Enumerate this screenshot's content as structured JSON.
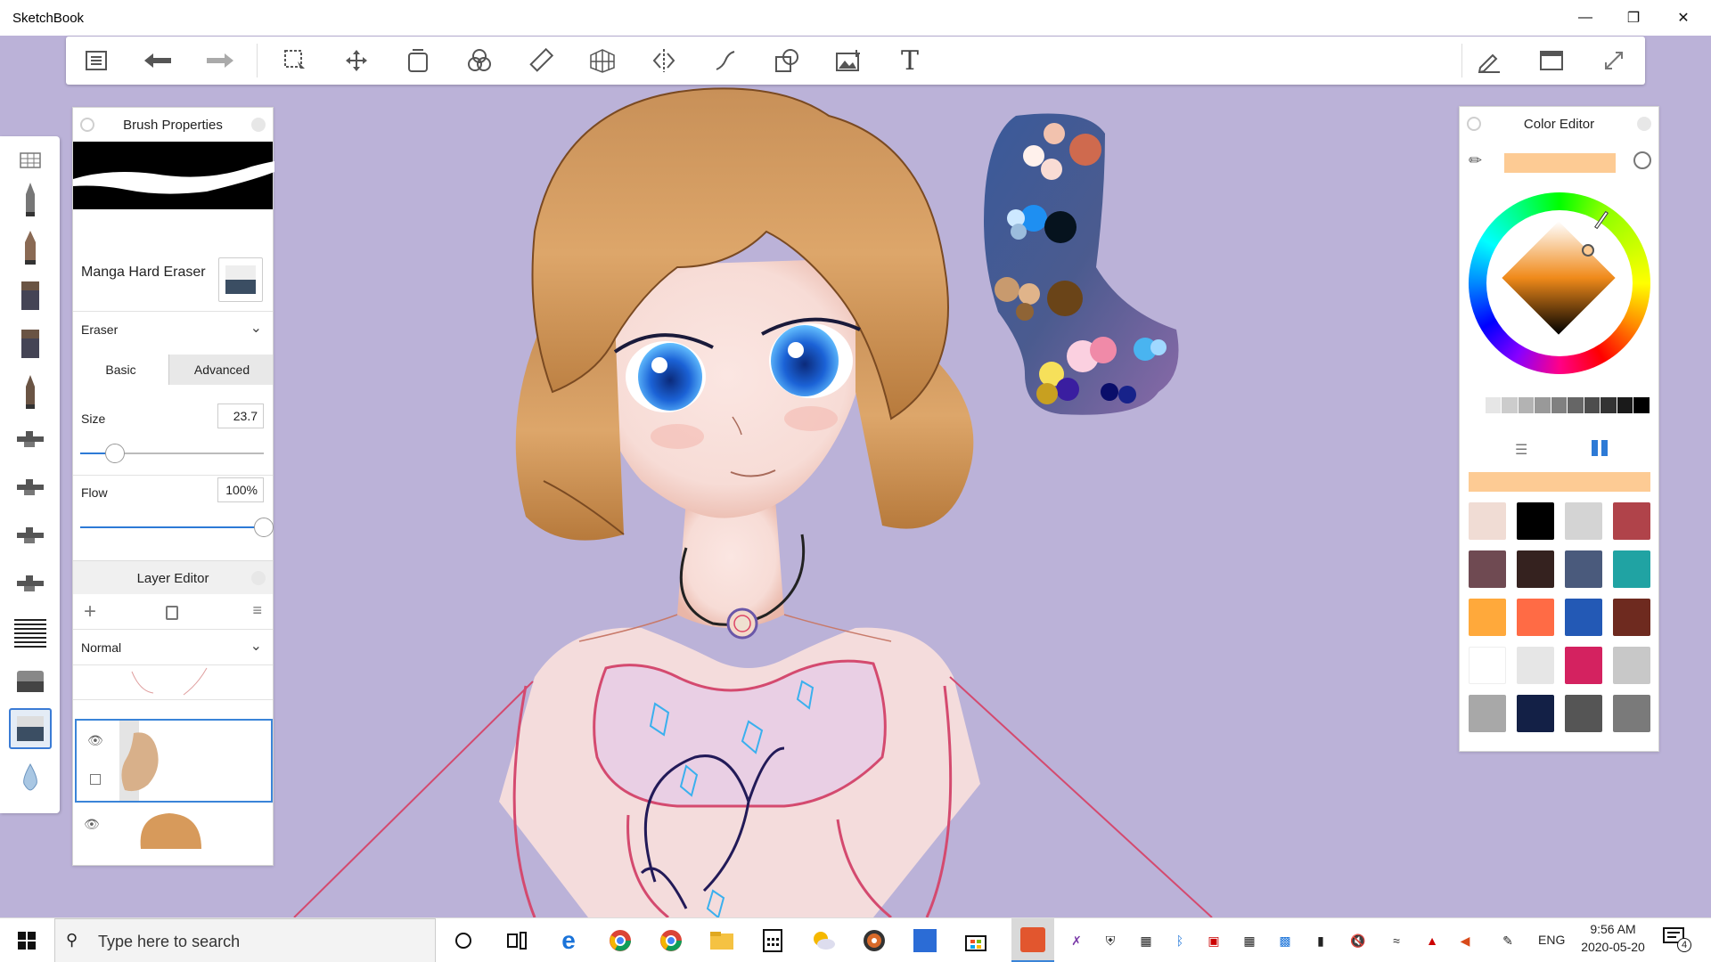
{
  "app": {
    "title": "SketchBook"
  },
  "window": {
    "minimize_icon": "minimize-icon",
    "restore_icon": "restore-icon",
    "close_icon": "close-icon"
  },
  "toolbar": {
    "icons": [
      "menu-list-icon",
      "undo-icon",
      "redo-icon",
      "selection-icon",
      "move-icon",
      "layer-fill-icon",
      "color-mix-icon",
      "ruler-icon",
      "perspective-icon",
      "symmetry-icon",
      "stroke-icon",
      "shape-icon",
      "insert-image-icon",
      "text-icon"
    ],
    "right_icons": [
      "pen-icon",
      "window-icon",
      "fullscreen-icon"
    ]
  },
  "brush": {
    "panel_title": "Brush Properties",
    "name": "Manga Hard Eraser",
    "category": "Eraser",
    "tab_basic": "Basic",
    "tab_advanced": "Advanced",
    "size_label": "Size",
    "size_value": "23.7",
    "size_fraction": 0.19,
    "flow_label": "Flow",
    "flow_value": "100%",
    "flow_fraction": 1.0
  },
  "layers": {
    "panel_title": "Layer Editor",
    "blend_mode": "Normal"
  },
  "color": {
    "panel_title": "Color Editor",
    "current": "#fdcb94",
    "grays": [
      "#ffffff",
      "#e6e6e6",
      "#cccccc",
      "#b3b3b3",
      "#999999",
      "#808080",
      "#666666",
      "#4d4d4d",
      "#333333",
      "#1a1a1a",
      "#000000"
    ],
    "swatches": [
      "#f0dcd4",
      "#000000",
      "#d4d4d4",
      "#b0434a",
      "#6f4a52",
      "#35221f",
      "#4a5a7c",
      "#20a3a3",
      "#ffa93b",
      "#ff6b45",
      "#2359b5",
      "#6e2a1f",
      "#ffffff",
      "#e6e6e6",
      "#d42260",
      "#c8c8c8",
      "#a8a8a8",
      "#132046",
      "#555555",
      "#7a7a7a"
    ]
  },
  "taskbar": {
    "search_placeholder": "Type here to search",
    "lang": "ENG",
    "time": "9:56 AM",
    "date": "2020-05-20",
    "notifications": "4"
  }
}
